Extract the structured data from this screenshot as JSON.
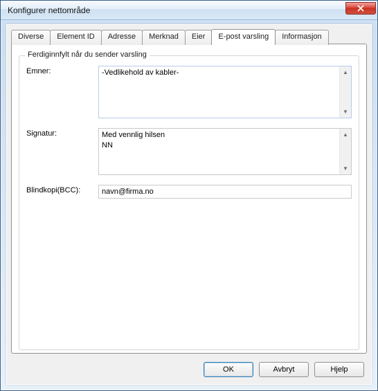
{
  "window": {
    "title": "Konfigurer nettområde"
  },
  "tabs": {
    "t0": "Diverse",
    "t1": "Element ID",
    "t2": "Adresse",
    "t3": "Merknad",
    "t4": "Eier",
    "t5": "E-post varsling",
    "t6": "Informasjon"
  },
  "group": {
    "legend": "Ferdiginnfylt når du sender varsling"
  },
  "labels": {
    "subjects": "Emner:",
    "signature": "Signatur:",
    "bcc": "Blindkopi(BCC):"
  },
  "values": {
    "subjects": "-Vedlikehold av kabler-",
    "signature": "Med vennlig hilsen\nNN",
    "bcc": "navn@firma.no"
  },
  "buttons": {
    "ok": "OK",
    "cancel": "Avbryt",
    "help": "Hjelp"
  }
}
